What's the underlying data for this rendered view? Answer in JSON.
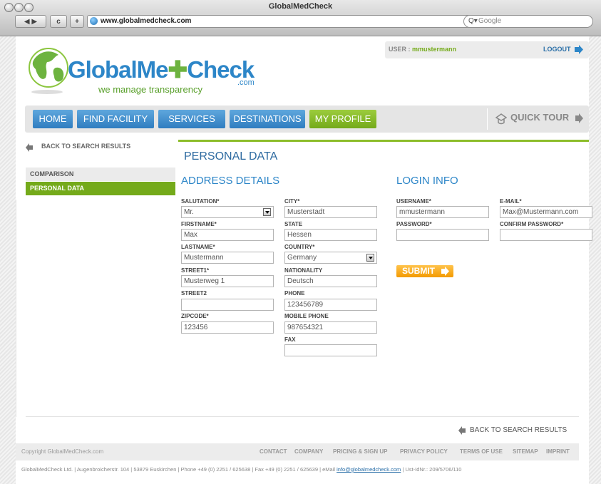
{
  "window": {
    "title": "GlobalMedCheck"
  },
  "browser": {
    "url": "www.globalmedcheck.com",
    "search_placeholder": "Google",
    "back_forward": "◀ ▶",
    "reload": "c",
    "add": "+"
  },
  "header": {
    "user_label": "USER :",
    "username": "mmustermann",
    "logout": "LOGOUT",
    "logo_main_1": "GlobalMe",
    "logo_main_2": "Check",
    "logo_com": ".com",
    "tagline": "we manage transparency"
  },
  "nav": {
    "items": [
      {
        "label": "HOME"
      },
      {
        "label": "FIND FACILITY"
      },
      {
        "label": "SERVICES"
      },
      {
        "label": "DESTINATIONS"
      },
      {
        "label": "MY PROFILE"
      }
    ],
    "quick_tour": "QUICK TOUR"
  },
  "sidebar": {
    "back_label": "BACK TO SEARCH RESULTS",
    "items": [
      {
        "label": "COMPARISON"
      },
      {
        "label": "PERSONAL DATA"
      }
    ]
  },
  "main": {
    "title": "PERSONAL DATA",
    "address_title": "ADDRESS DETAILS",
    "login_title": "LOGIN INFO",
    "fields": {
      "salutation": {
        "label": "SALUTATION*",
        "value": "Mr."
      },
      "firstname": {
        "label": "FIRSTNAME*",
        "value": "Max"
      },
      "lastname": {
        "label": "LASTNAME*",
        "value": "Mustermann"
      },
      "street1": {
        "label": "STREET1*",
        "value": "Musterweg 1"
      },
      "street2": {
        "label": "STREET2",
        "value": ""
      },
      "zipcode": {
        "label": "ZIPCODE*",
        "value": "123456"
      },
      "city": {
        "label": "CITY*",
        "value": "Musterstadt"
      },
      "state": {
        "label": "STATE",
        "value": "Hessen"
      },
      "country": {
        "label": "COUNTRY*",
        "value": "Germany"
      },
      "nationality": {
        "label": "NATIONALITY",
        "value": "Deutsch"
      },
      "phone": {
        "label": "PHONE",
        "value": "123456789"
      },
      "mobile": {
        "label": "MOBILE PHONE",
        "value": "987654321"
      },
      "fax": {
        "label": "FAX",
        "value": ""
      },
      "username": {
        "label": "USERNAME*",
        "value": "mmustermann"
      },
      "password": {
        "label": "PASSWORD*",
        "value": ""
      },
      "email": {
        "label": "E-MAIL*",
        "value": "Max@Mustermann.com"
      },
      "confirm_password": {
        "label": "CONFIRM PASSWORD*",
        "value": ""
      }
    },
    "submit": "SUBMIT",
    "back_bottom": "BACK TO SEARCH RESULTS"
  },
  "footer": {
    "copyright": "Copyright GlobalMedCheck.com",
    "links": [
      {
        "label": "CONTACT"
      },
      {
        "label": "COMPANY"
      },
      {
        "label": "PRICING & SIGN UP"
      },
      {
        "label": "PRIVACY POLICY"
      },
      {
        "label": "TERMS OF USE"
      },
      {
        "label": "SITEMAP"
      },
      {
        "label": "IMPRINT"
      }
    ],
    "address_pre": "GlobalMedCheck Ltd. | Augenbroicherstr. 104 | 53879 Euskirchen | Phone +49 (0) 2251 / 625638 | Fax +49 (0) 2251 / 625639 | eMail ",
    "email": "info@globalmedcheck.com",
    "address_post": " | Ust-IdNr.: 209/5706/110"
  },
  "colors": {
    "brand_blue": "#2d86c8",
    "brand_green": "#74aa1a",
    "submit_orange": "#f39a00"
  },
  "icons": [
    "globe-logo-icon",
    "logout-arrow-icon",
    "quick-tour-hat-icon",
    "back-arrow-icon",
    "submit-arrow-icon",
    "select-arrow-icon"
  ]
}
